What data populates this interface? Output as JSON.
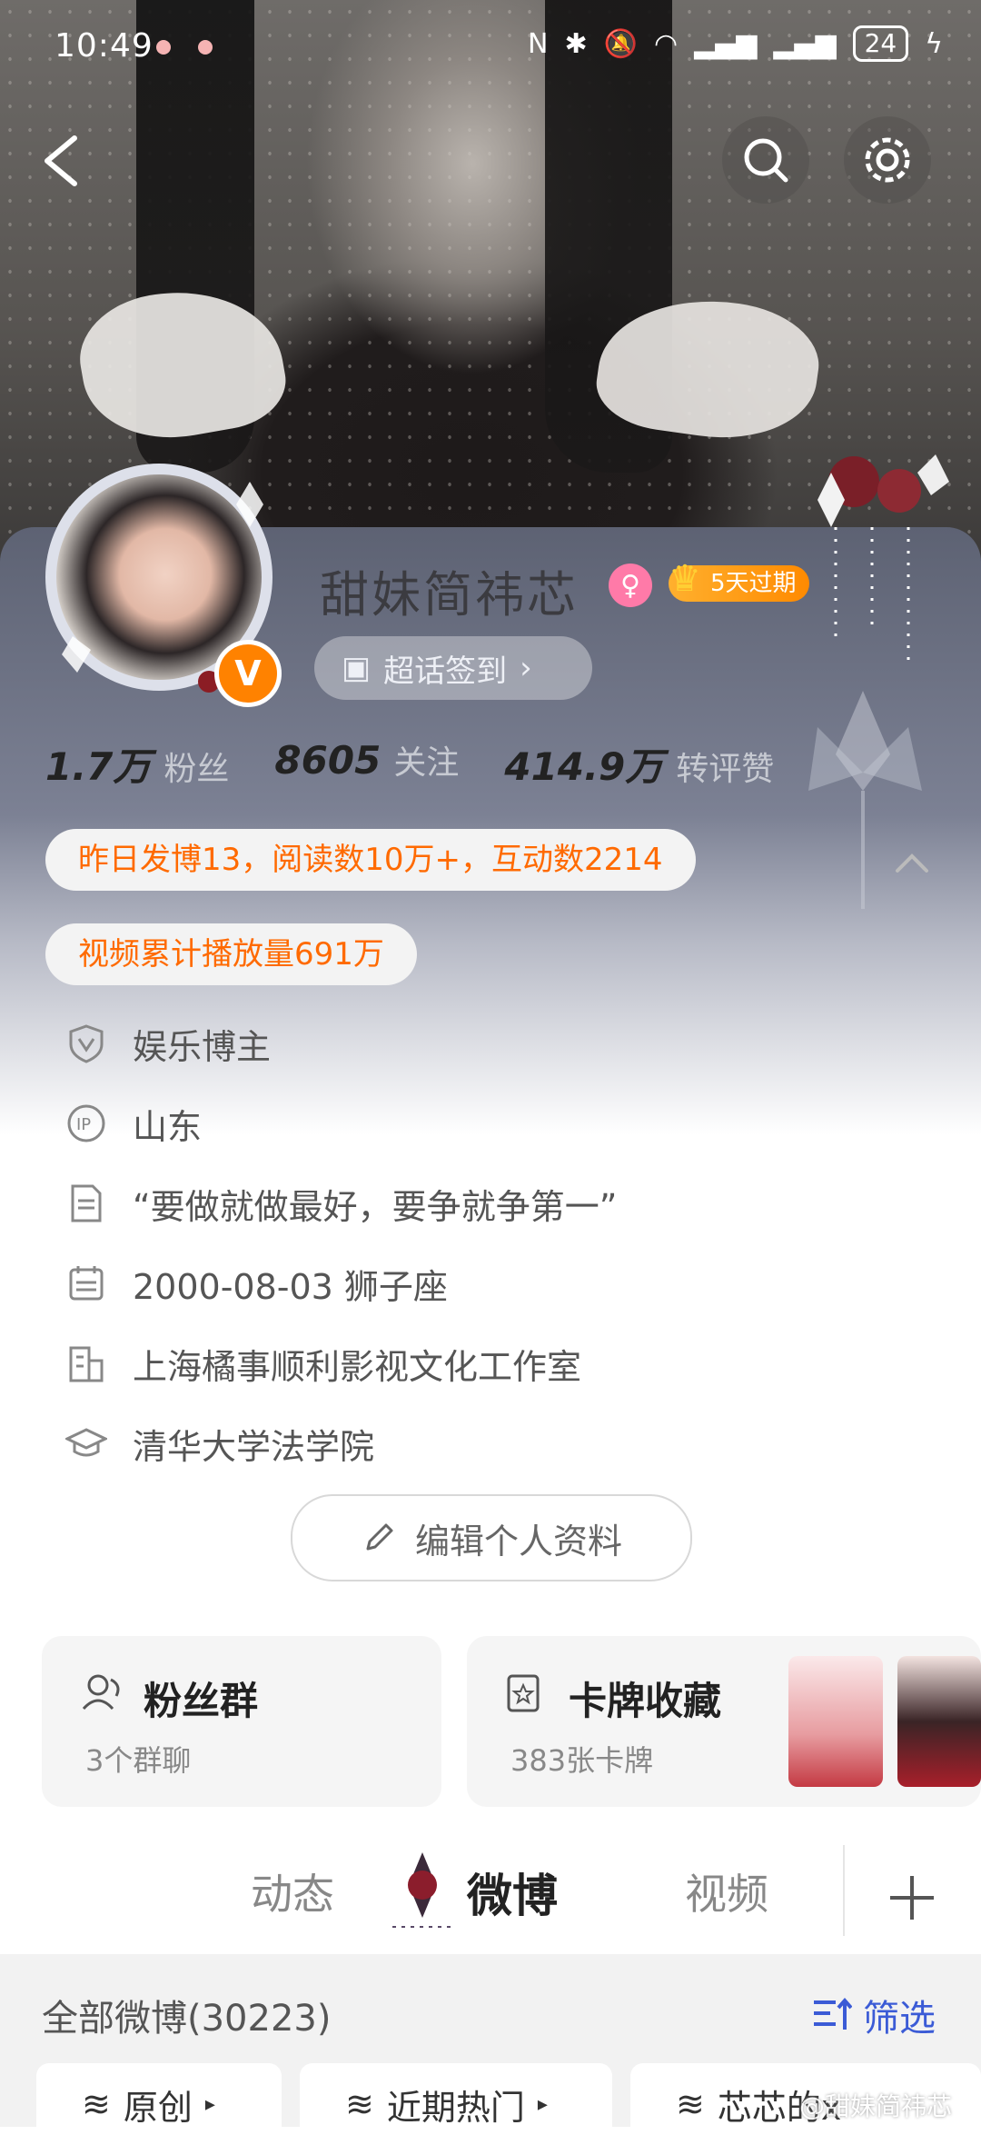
{
  "status_bar": {
    "time": "10:49",
    "battery": "24"
  },
  "profile": {
    "name": "甜妹简祎芯",
    "vip_badge": "5天过期",
    "checkin_label": "超话签到",
    "stats": [
      {
        "value": "1.7万",
        "label": "粉丝"
      },
      {
        "value": "8605",
        "label": "关注"
      },
      {
        "value": "414.9万",
        "label": "转评赞"
      }
    ],
    "highlight_pills": [
      "昨日发博13，阅读数10万+，互动数2214",
      "视频累计播放量691万"
    ],
    "info": [
      {
        "icon": "verified-shield-icon",
        "text": "娱乐博主"
      },
      {
        "icon": "ip-icon",
        "text": "山东"
      },
      {
        "icon": "document-icon",
        "text": "“要做就做最好，要争就争第一”"
      },
      {
        "icon": "calendar-icon",
        "text": "2000-08-03 狮子座"
      },
      {
        "icon": "company-icon",
        "text": "上海橘事顺利影视文化工作室"
      },
      {
        "icon": "graduation-cap-icon",
        "text": "清华大学法学院"
      }
    ],
    "edit_label": "编辑个人资料"
  },
  "tiles": {
    "fans_group": {
      "title": "粉丝群",
      "subtitle": "3个群聊"
    },
    "cards": {
      "title": "卡牌收藏",
      "subtitle": "383张卡牌"
    }
  },
  "tabs": [
    "动态",
    "微博",
    "视频"
  ],
  "feed": {
    "all_label": "全部微博(30223)",
    "filter_label": "筛选",
    "chips": [
      "原创",
      "近期热门",
      "芯芯的x"
    ]
  },
  "watermark": "@甜妹简祎芯",
  "colors": {
    "accent_orange": "#ff6a00",
    "vip_orange": "#ff8200",
    "filter_blue": "#3b5bd6"
  }
}
